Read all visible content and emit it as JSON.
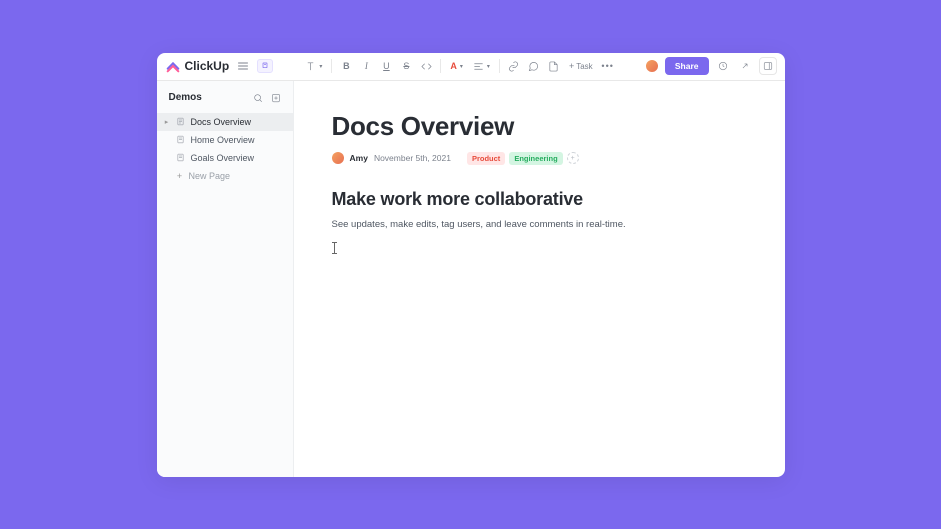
{
  "brand": "ClickUp",
  "header": {
    "share_label": "Share",
    "task_label": "Task"
  },
  "sidebar": {
    "title": "Demos",
    "items": [
      {
        "label": "Docs Overview",
        "active": true
      },
      {
        "label": "Home Overview",
        "active": false
      },
      {
        "label": "Goals Overview",
        "active": false
      }
    ],
    "new_page": "New Page"
  },
  "doc": {
    "title": "Docs Overview",
    "author": "Amy",
    "date": "November 5th, 2021",
    "tags": [
      {
        "label": "Product",
        "kind": "product"
      },
      {
        "label": "Engineering",
        "kind": "engineering"
      }
    ],
    "heading": "Make work more collaborative",
    "body": "See updates, make edits, tag users, and leave comments in real-time."
  }
}
